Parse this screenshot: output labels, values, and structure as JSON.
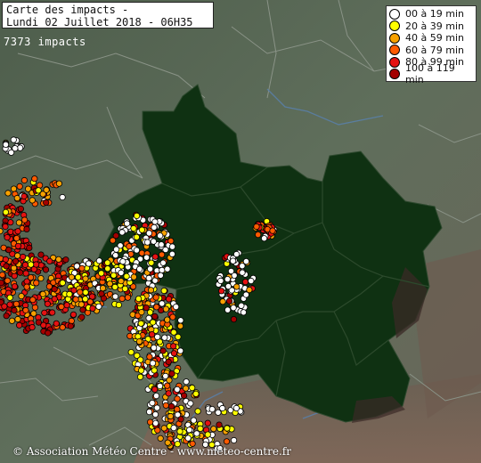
{
  "header": {
    "title_line1": "Carte des impacts -",
    "title_line2": "Lundi 02 Juillet 2018 - 06H35"
  },
  "impact_count": "7373 impacts",
  "legend": [
    {
      "label": "00 à 19 min",
      "color": "#ffffff"
    },
    {
      "label": "20 à 39 min",
      "color": "#ffff00"
    },
    {
      "label": "40 à 59 min",
      "color": "#f7a100"
    },
    {
      "label": "60 à 79 min",
      "color": "#ff5a00"
    },
    {
      "label": "80 à 99 min",
      "color": "#e41212"
    },
    {
      "label": "100 à 119 min",
      "color": "#a40000"
    }
  ],
  "copyright": "© Association Météo Centre - www.meteo-centre.fr",
  "colors": {
    "terrain": "#5b6b58",
    "centre_region": "#0f3112",
    "borders": "#8a9387",
    "rivers": "#5a7fa6"
  }
}
